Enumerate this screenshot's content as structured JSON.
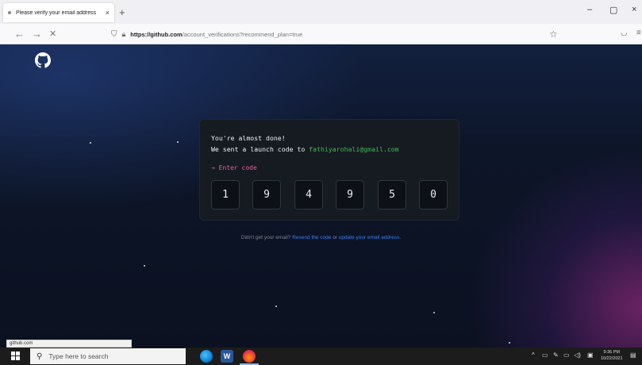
{
  "browser": {
    "tab_title": "Please verify your email address",
    "tab_close": "×",
    "new_tab": "+",
    "minimize": "–",
    "maximize": "▢",
    "close": "×",
    "back": "←",
    "forward": "→",
    "stop": "✕",
    "url_host": "https://github.com",
    "url_path": "/account_verifications?recommend_plan=true",
    "status_text": "github.com"
  },
  "page": {
    "line1": "You're almost done!",
    "line2_prefix": "We sent a launch code to ",
    "email": "fathiyarohali@gmail.com",
    "prompt": "→ Enter code",
    "code_digits": [
      "1",
      "9",
      "4",
      "9",
      "5",
      "0"
    ],
    "help_prefix": "Didn't get your email? ",
    "resend_link": "Resend the code",
    "help_or": " or ",
    "update_link": "update your email address",
    "help_suffix": "."
  },
  "taskbar": {
    "search_placeholder": "Type here to search",
    "time": "9:36 PM",
    "date": "10/22/2021"
  },
  "colors": {
    "accent_green": "#3fb950",
    "prompt_pink": "#db61a2",
    "link_blue": "#2f81f7"
  }
}
